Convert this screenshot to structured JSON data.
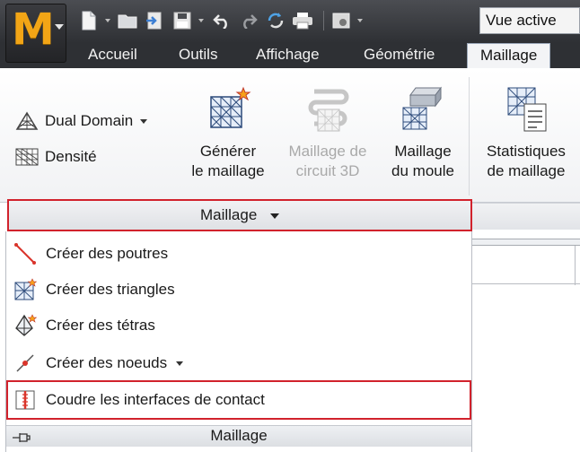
{
  "app": {
    "logo_letter": "M"
  },
  "quick_access": {
    "view_selector": "Vue active"
  },
  "tabs": [
    {
      "label": "Accueil"
    },
    {
      "label": "Outils"
    },
    {
      "label": "Affichage"
    },
    {
      "label": "Géométrie"
    },
    {
      "label": "Maillage"
    }
  ],
  "ribbon": {
    "dual_domain": "Dual Domain",
    "density": "Densité",
    "generate": {
      "line1": "Générer",
      "line2": "le maillage"
    },
    "circuit": {
      "line1": "Maillage de",
      "line2": "circuit 3D"
    },
    "mold": {
      "line1": "Maillage",
      "line2": "du moule"
    },
    "stats": {
      "line1": "Statistiques",
      "line2": "de maillage"
    },
    "panel_title": "Maillage"
  },
  "menu": {
    "items": [
      {
        "label": "Créer des poutres"
      },
      {
        "label": "Créer des triangles"
      },
      {
        "label": "Créer des tétras"
      },
      {
        "label": "Créer des noeuds"
      },
      {
        "label": "Coudre les interfaces de contact"
      }
    ],
    "footer": "Maillage"
  },
  "colors": {
    "accent": "#f2a516",
    "highlight_border": "#d1222c",
    "title_bar": "#2e3034"
  }
}
